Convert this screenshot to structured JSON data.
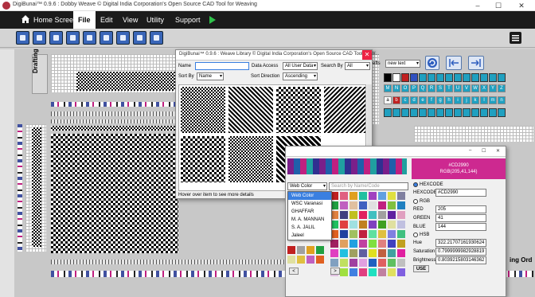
{
  "window": {
    "title": "DigiBunai™ 0.9.6 : Dobby Weave © Digital India Corporation's Open Source CAD Tool for Weaving",
    "min": "–",
    "max": "☐",
    "close": "✕"
  },
  "menu": {
    "home": "Home Screen",
    "items": [
      "File",
      "Edit",
      "View",
      "Utility",
      "Support"
    ]
  },
  "panels": {
    "drafting": "Drafting",
    "ord": "ing Ord"
  },
  "right_panel": {
    "weft_label": "efts",
    "select": "new text"
  },
  "palette_letters": {
    "row1": [
      "",
      "",
      "",
      "",
      "",
      "",
      "",
      "",
      "",
      "",
      "",
      "",
      "",
      ""
    ],
    "row2": [
      "M",
      "N",
      "O",
      "P",
      "Q",
      "R",
      "S",
      "T",
      "U",
      "V",
      "W",
      "X",
      "Y",
      "Z"
    ],
    "row3": [
      "a",
      "b",
      "c",
      "d",
      "e",
      "f",
      "g",
      "h",
      "i",
      "j",
      "k",
      "l",
      "m",
      "n"
    ]
  },
  "library": {
    "title": "DigiBunai™ 0.9.6 : Weave Library © Digital India Corporation's Open Source CAD Tool for W...",
    "name_label": "Name",
    "data_access_label": "Data Access",
    "data_access_value": "All User Data",
    "search_by_label": "Search By",
    "search_by_value": "All",
    "sort_by_label": "Sort By",
    "sort_by_value": "Name",
    "sort_dir_label": "Sort Direction",
    "sort_dir_value": "Ascending",
    "hover_hint": "Hover over item to see more details"
  },
  "color": {
    "preview_hex": "#CD2990",
    "preview_rgb": "RGB(205,41,144)",
    "color_type": "Web Color",
    "search_placeholder": "Search by Name/Code",
    "types": [
      "Web Color",
      "WSC Varanasi",
      "GHAFFAR",
      "M. A. MANNAN",
      "S. A. JALIL",
      "Jaleel"
    ],
    "hexcode_radio": "HEXCODE",
    "hexcode_label": "HEXCODE",
    "hexcode_value": "#CD2990",
    "rgb_radio": "RGB",
    "red_label": "RED",
    "red_value": "205",
    "green_label": "GREEN",
    "green_value": "41",
    "blue_label": "BLUE",
    "blue_value": "144",
    "hsb_radio": "HSB",
    "hue_label": "Hue",
    "hue_value": "322.21707161930624",
    "sat_label": "Saturation",
    "sat_value": "0.7999999982928819",
    "bri_label": "Brightness",
    "bri_value": "0.8039215803146362",
    "use_button": "USE",
    "prev": "<",
    "next": ">"
  },
  "colors": {
    "accent": "#CD2990",
    "menubar": "#1b1b1b",
    "toolbar_icon": "#3a66b8"
  }
}
